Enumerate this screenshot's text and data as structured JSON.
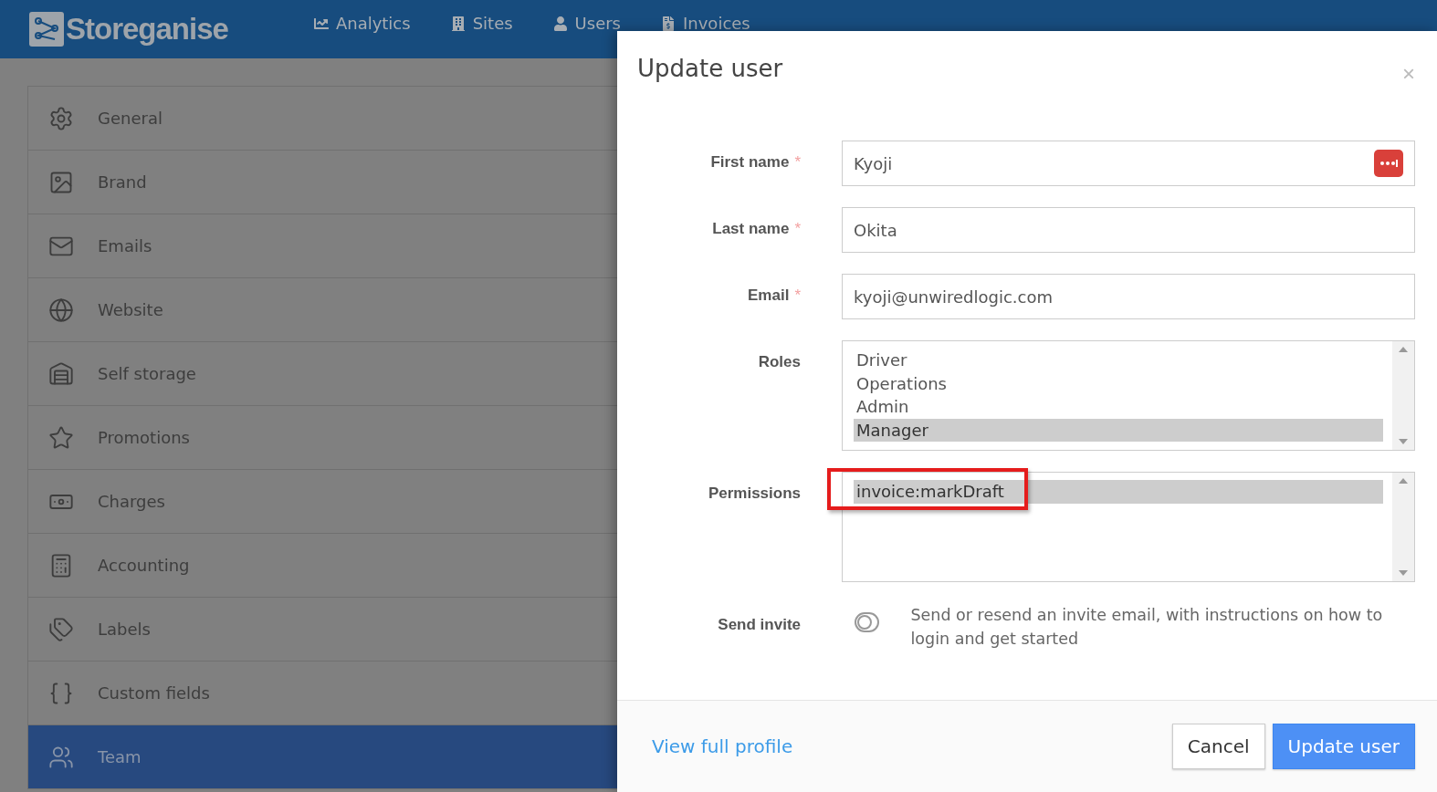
{
  "nav": {
    "logo": "Storeganise",
    "items": [
      {
        "label": "Analytics"
      },
      {
        "label": "Sites"
      },
      {
        "label": "Users"
      },
      {
        "label": "Invoices"
      }
    ]
  },
  "sidebar": {
    "items": [
      {
        "label": "General",
        "selected": false
      },
      {
        "label": "Brand",
        "selected": false
      },
      {
        "label": "Emails",
        "selected": false
      },
      {
        "label": "Website",
        "selected": false
      },
      {
        "label": "Self storage",
        "selected": false
      },
      {
        "label": "Promotions",
        "selected": false
      },
      {
        "label": "Charges",
        "selected": false
      },
      {
        "label": "Accounting",
        "selected": false
      },
      {
        "label": "Labels",
        "selected": false
      },
      {
        "label": "Custom fields",
        "selected": false
      },
      {
        "label": "Team",
        "selected": true
      }
    ]
  },
  "modal": {
    "title": "Update user",
    "close": "×",
    "fields": [
      {
        "label": "First name",
        "required": "*",
        "value": "Kyoji",
        "password_manager": true
      },
      {
        "label": "Last name",
        "required": "*",
        "value": "Okita",
        "password_manager": false
      },
      {
        "label": "Email",
        "required": "*",
        "value": "kyoji@unwiredlogic.com",
        "password_manager": false
      }
    ],
    "roles": {
      "label": "Roles",
      "options": [
        {
          "label": "Driver",
          "selected": false
        },
        {
          "label": "Operations",
          "selected": false
        },
        {
          "label": "Admin",
          "selected": false
        },
        {
          "label": "Manager",
          "selected": true
        }
      ]
    },
    "permissions": {
      "label": "Permissions",
      "options": [
        {
          "label": "invoice:markDraft",
          "selected": true,
          "highlighted": true
        }
      ]
    },
    "send_invite": {
      "label": "Send invite",
      "on": false,
      "help": "Send or resend an invite email, with instructions on how to login and get started"
    },
    "footer": {
      "link": "View full profile",
      "cancel": "Cancel",
      "submit": "Update user"
    }
  }
}
